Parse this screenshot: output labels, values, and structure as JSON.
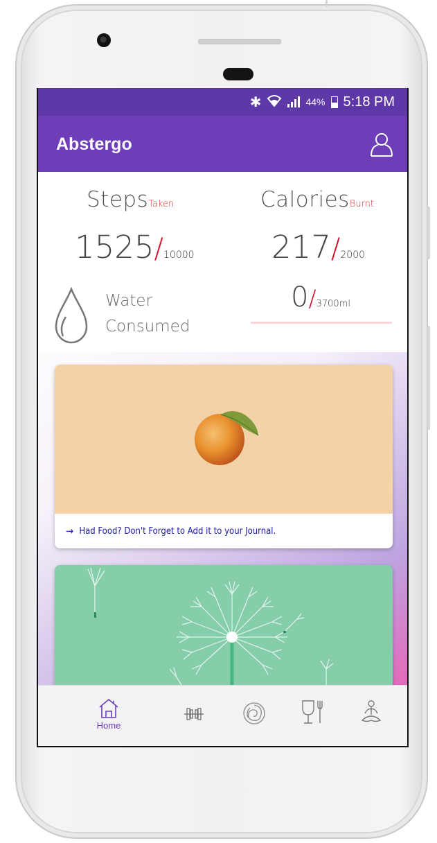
{
  "status_bar": {
    "battery_percent": "44%",
    "time": "5:18 PM",
    "icons": [
      "bluetooth-icon",
      "wifi-icon",
      "signal-icon",
      "battery-icon"
    ]
  },
  "app_bar": {
    "title": "Abstergo",
    "profile_icon": "profile-icon"
  },
  "stats": {
    "steps": {
      "label": "Steps",
      "sub": "Taken",
      "value": "1525",
      "slash": "/",
      "max": "10000"
    },
    "calories": {
      "label": "Calories",
      "sub": "Burnt",
      "value": "217",
      "slash": "/",
      "max": "2000"
    },
    "water": {
      "label_line1": "Water",
      "label_line2": "Consumed",
      "value": "0",
      "slash": "/",
      "max": "3700ml",
      "icon": "water-drop-icon"
    }
  },
  "cards": {
    "food": {
      "caption": "Had Food? Don't Forget to Add it to your Journal.",
      "arrow": "→",
      "image": "peach-image"
    },
    "meditation": {
      "image": "dandelion-image"
    }
  },
  "bottom_nav": {
    "items": [
      {
        "icon": "home-icon",
        "label": "Home",
        "active": true
      },
      {
        "icon": "dumbbell-icon",
        "label": ""
      },
      {
        "icon": "swirl-icon",
        "label": ""
      },
      {
        "icon": "food-glass-icon",
        "label": ""
      },
      {
        "icon": "meditation-icon",
        "label": ""
      }
    ]
  },
  "colors": {
    "status_bar": "#5f38a8",
    "app_bar": "#6d3eb8",
    "accent_red": "#d0102a",
    "food_card": "#f2d2a6",
    "meditation_card": "#86cdaa",
    "caption_text": "#1a1aa6"
  }
}
